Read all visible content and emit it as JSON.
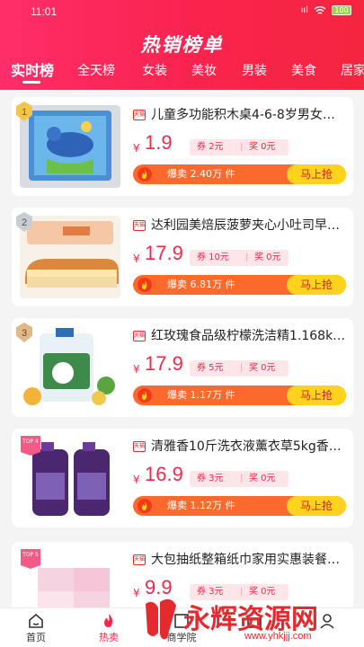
{
  "status_bar": {
    "time": "11:01",
    "signal_text": "ııl",
    "battery": "100"
  },
  "header": {
    "title": "热销榜单"
  },
  "tabs": [
    "实时榜",
    "全天榜",
    "女装",
    "美妆",
    "男装",
    "美食",
    "居家"
  ],
  "active_tab": 0,
  "products": [
    {
      "rank": "1",
      "shop_tag": "天猫",
      "name": "儿童多功能积木桌4-6-8岁男女…",
      "currency": "¥",
      "price": "1.9",
      "coupon": "券 2元",
      "reward": "奖 0元",
      "sales": "爆卖 2.40万 件",
      "buy": "马上抢"
    },
    {
      "rank": "2",
      "shop_tag": "天猫",
      "name": "达利园美焙辰菠萝夹心小吐司早…",
      "currency": "¥",
      "price": "17.9",
      "coupon": "券 10元",
      "reward": "奖 0元",
      "sales": "爆卖 6.81万 件",
      "buy": "马上抢"
    },
    {
      "rank": "3",
      "shop_tag": "天猫",
      "name": "红玫瑰食品级柠檬洗洁精1.168k…",
      "currency": "¥",
      "price": "17.9",
      "coupon": "券 5元",
      "reward": "奖 0元",
      "sales": "爆卖 1.17万 件",
      "buy": "马上抢"
    },
    {
      "rank": "TOP 4",
      "shop_tag": "天猫",
      "name": "清雅香10斤洗衣液薰衣草5kg香…",
      "currency": "¥",
      "price": "16.9",
      "coupon": "券 3元",
      "reward": "奖 0元",
      "sales": "爆卖 1.12万 件",
      "buy": "马上抢"
    },
    {
      "rank": "TOP 5",
      "shop_tag": "天猫",
      "name": "大包抽纸整箱纸巾家用实惠装餐…",
      "currency": "¥",
      "price": "9.9",
      "coupon": "券 3元",
      "reward": "奖 0元",
      "sales": "",
      "buy": ""
    }
  ],
  "bottom_nav": [
    {
      "label": "首页",
      "icon": "home-icon"
    },
    {
      "label": "热卖",
      "icon": "fire-icon"
    },
    {
      "label": "商学院",
      "icon": "book-icon"
    },
    {
      "label": "",
      "icon": "gift-icon"
    },
    {
      "label": "",
      "icon": "user-icon"
    }
  ],
  "watermark": {
    "text": "永辉资源网",
    "url": "www.yhkjjj.com"
  },
  "colors": {
    "accent": "#f3274a",
    "header_start": "#ff2d6a",
    "header_end": "#f5253f",
    "buy_button": "#ffd21e",
    "sales_bar": "#fb6a2c"
  }
}
